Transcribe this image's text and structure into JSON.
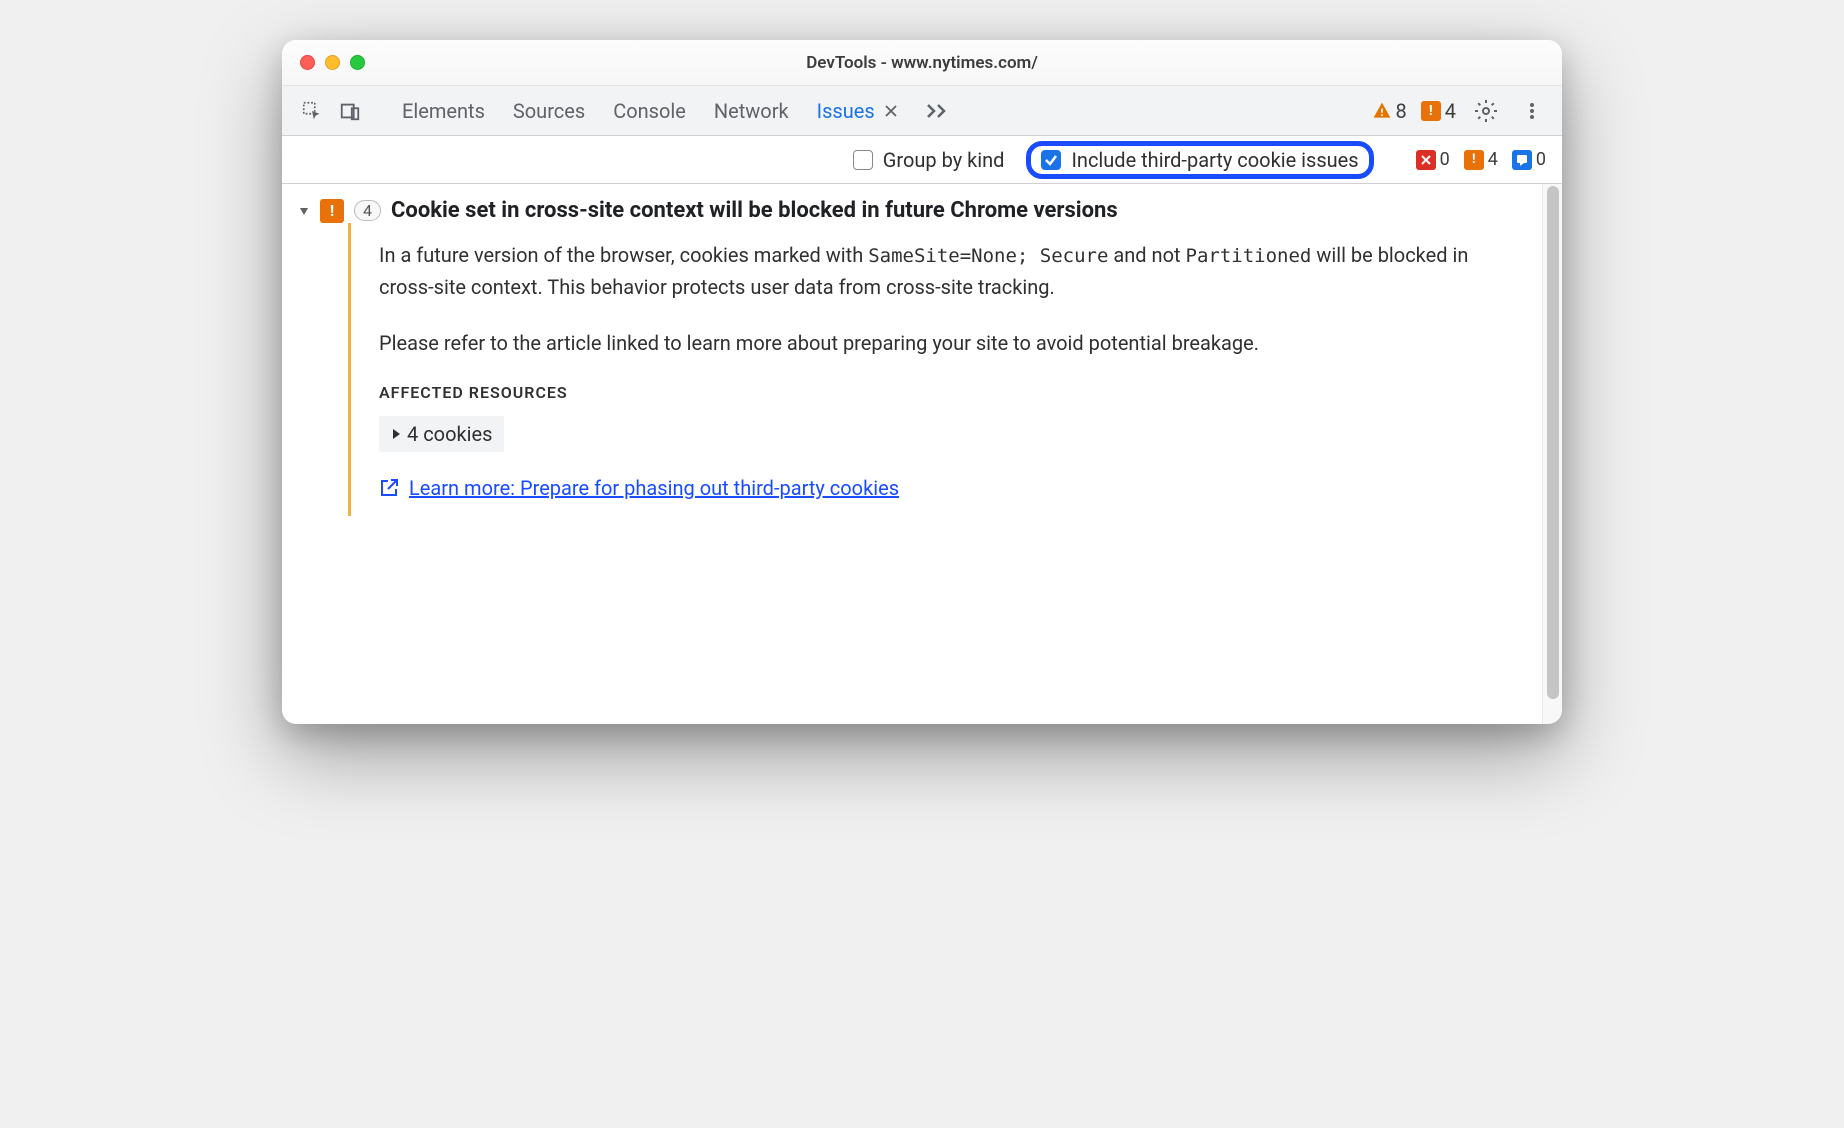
{
  "window": {
    "title": "DevTools - www.nytimes.com/"
  },
  "tabs": {
    "elements": "Elements",
    "sources": "Sources",
    "console": "Console",
    "network": "Network",
    "issues": "Issues"
  },
  "toolbar_counts": {
    "warnings": "8",
    "errors": "4"
  },
  "filter_bar": {
    "group_by_kind": "Group by kind",
    "include_third_party": "Include third-party cookie issues",
    "group_checked": false,
    "third_party_checked": true,
    "counts": {
      "red": "0",
      "orange": "4",
      "blue": "0"
    }
  },
  "issue": {
    "count": "4",
    "title": "Cookie set in cross-site context will be blocked in future Chrome versions",
    "desc_part1": "In a future version of the browser, cookies marked with ",
    "desc_code1": "SameSite=None; Secure",
    "desc_part2": " and not ",
    "desc_code2": "Partitioned",
    "desc_part3": " will be blocked in cross-site context. This behavior protects user data from cross-site tracking.",
    "desc_p2": "Please refer to the article linked to learn more about preparing your site to avoid potential breakage.",
    "affected_heading": "AFFECTED RESOURCES",
    "cookies_row": "4 cookies",
    "learn_more": "Learn more: Prepare for phasing out third-party cookies"
  }
}
